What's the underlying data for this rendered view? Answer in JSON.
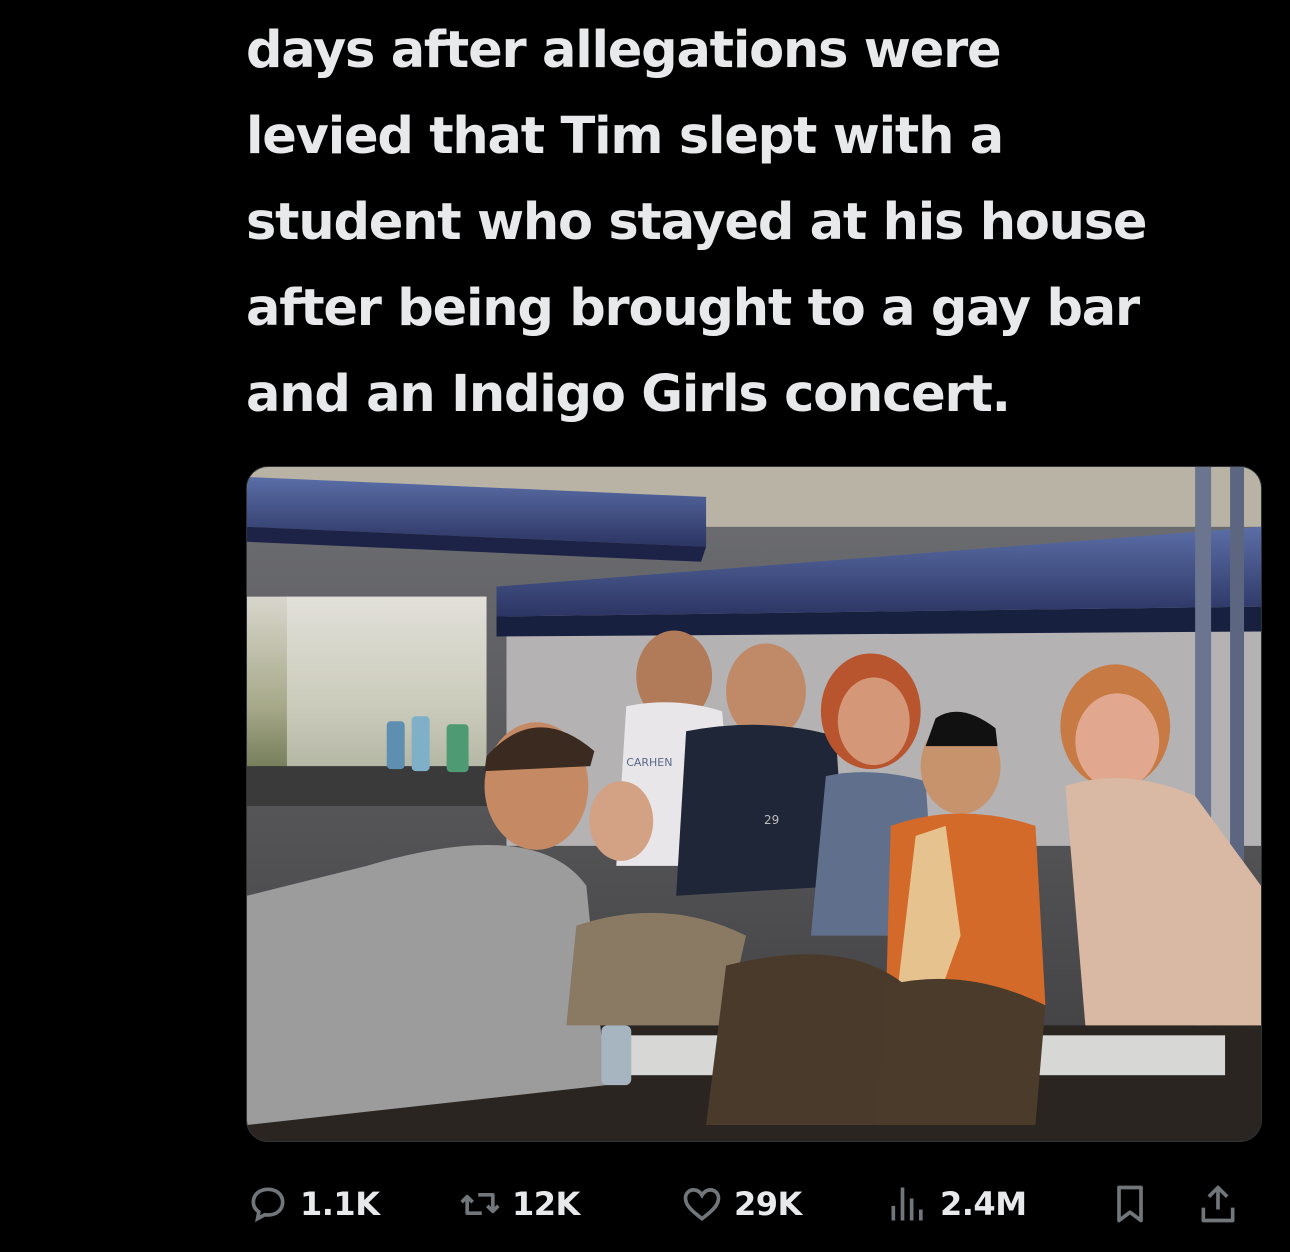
{
  "tweet": {
    "text_lines": [
      "days after allegations were",
      "levied that Tim slept with a",
      "student who stayed at his house",
      "after being brought to a gay bar",
      "and an Indigo Girls concert."
    ]
  },
  "media": {
    "shirt_text_1": "CARHEN",
    "shirt_text_2": "29"
  },
  "actions": {
    "reply_count": "1.1K",
    "retweet_count": "12K",
    "like_count": "29K",
    "views_count": "2.4M"
  },
  "icons": {
    "reply": "reply-icon",
    "retweet": "retweet-icon",
    "like": "heart-icon",
    "views": "views-icon",
    "bookmark": "bookmark-icon",
    "share": "share-icon"
  },
  "colors": {
    "background": "#000000",
    "text": "#e7e9ea",
    "icon": "#71767b"
  }
}
